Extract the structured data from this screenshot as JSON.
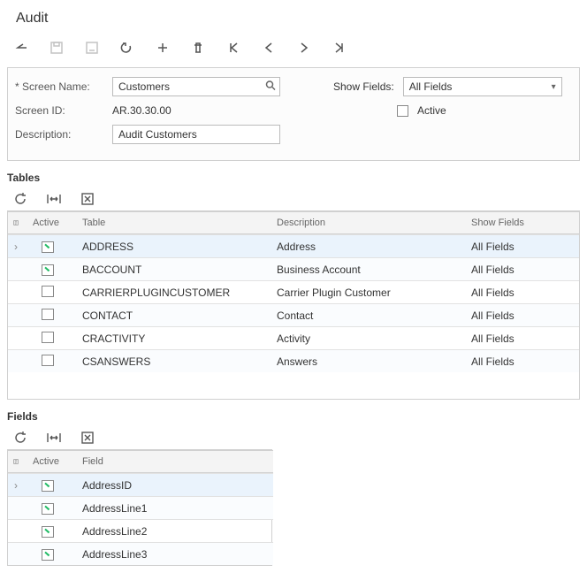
{
  "title": "Audit",
  "form": {
    "screenNameLabel": "Screen Name:",
    "screenName": "Customers",
    "screenIdLabel": "Screen ID:",
    "screenId": "AR.30.30.00",
    "descriptionLabel": "Description:",
    "description": "Audit Customers",
    "showFieldsLabel": "Show Fields:",
    "showFieldsValue": "All Fields",
    "activeLabel": "Active",
    "activeChecked": false
  },
  "sections": {
    "tables": "Tables",
    "fields": "Fields"
  },
  "tablesHeaders": {
    "active": "Active",
    "table": "Table",
    "description": "Description",
    "showFields": "Show Fields"
  },
  "tables": [
    {
      "active": true,
      "table": "ADDRESS",
      "desc": "Address",
      "show": "All Fields",
      "selected": true
    },
    {
      "active": true,
      "table": "BACCOUNT",
      "desc": "Business Account",
      "show": "All Fields",
      "selected": false
    },
    {
      "active": false,
      "table": "CARRIERPLUGINCUSTOMER",
      "desc": "Carrier Plugin Customer",
      "show": "All Fields",
      "selected": false
    },
    {
      "active": false,
      "table": "CONTACT",
      "desc": "Contact",
      "show": "All Fields",
      "selected": false
    },
    {
      "active": false,
      "table": "CRACTIVITY",
      "desc": "Activity",
      "show": "All Fields",
      "selected": false
    },
    {
      "active": false,
      "table": "CSANSWERS",
      "desc": "Answers",
      "show": "All Fields",
      "selected": false
    }
  ],
  "fieldsHeaders": {
    "active": "Active",
    "field": "Field"
  },
  "fields": [
    {
      "active": true,
      "field": "AddressID",
      "selected": true
    },
    {
      "active": true,
      "field": "AddressLine1",
      "selected": false
    },
    {
      "active": true,
      "field": "AddressLine2",
      "selected": false
    },
    {
      "active": true,
      "field": "AddressLine3",
      "selected": false
    }
  ]
}
